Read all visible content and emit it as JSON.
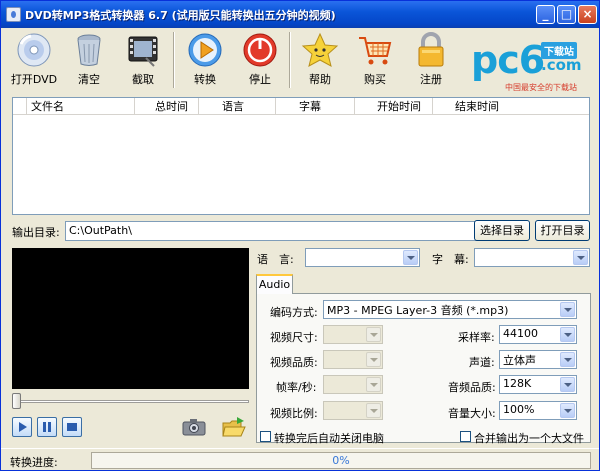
{
  "window": {
    "title": "DVD转MP3格式转换器 6.7 (试用版只能转换出五分钟的视频)"
  },
  "toolbar": {
    "open_dvd": "打开DVD",
    "clear": "清空",
    "capture": "截取",
    "convert": "转换",
    "stop": "停止",
    "help": "帮助",
    "buy": "购买",
    "register": "注册"
  },
  "logo": {
    "brand": "pc6",
    "download": "下载站",
    "domain": ".com",
    "slogan": "中国最安全的下载站"
  },
  "file_list": {
    "columns": [
      "文件名",
      "总时间",
      "语言",
      "字幕",
      "开始时间",
      "结束时间"
    ],
    "rows": []
  },
  "output": {
    "label": "输出目录:",
    "path": "C:\\OutPath\\",
    "choose_btn": "选择目录",
    "open_btn": "打开目录"
  },
  "language_label": "语　言:",
  "subtitle_label": "字　幕:",
  "tab": {
    "label": "Audio"
  },
  "audio": {
    "codec_label": "编码方式:",
    "codec_value": "MP3 - MPEG Layer-3 音频 (*.mp3)",
    "video_size_label": "视频尺寸:",
    "video_quality_label": "视频品质:",
    "fps_label": "帧率/秒:",
    "aspect_label": "视频比例:",
    "samplerate_label": "采样率:",
    "samplerate_value": "44100",
    "channel_label": "声道:",
    "channel_value": "立体声",
    "audio_quality_label": "音频品质:",
    "audio_quality_value": "128K",
    "volume_label": "音量大小:",
    "volume_value": "100%"
  },
  "options": {
    "shutdown_label": "转换完后自动关闭电脑",
    "merge_label": "合并输出为一个大文件"
  },
  "status": {
    "label": "转换进度:",
    "progress_text": "0%",
    "progress": 0
  },
  "colors": {
    "accent": "#0a55d8",
    "progress_text": "#3878d8",
    "logo": "#1aa0d8"
  }
}
